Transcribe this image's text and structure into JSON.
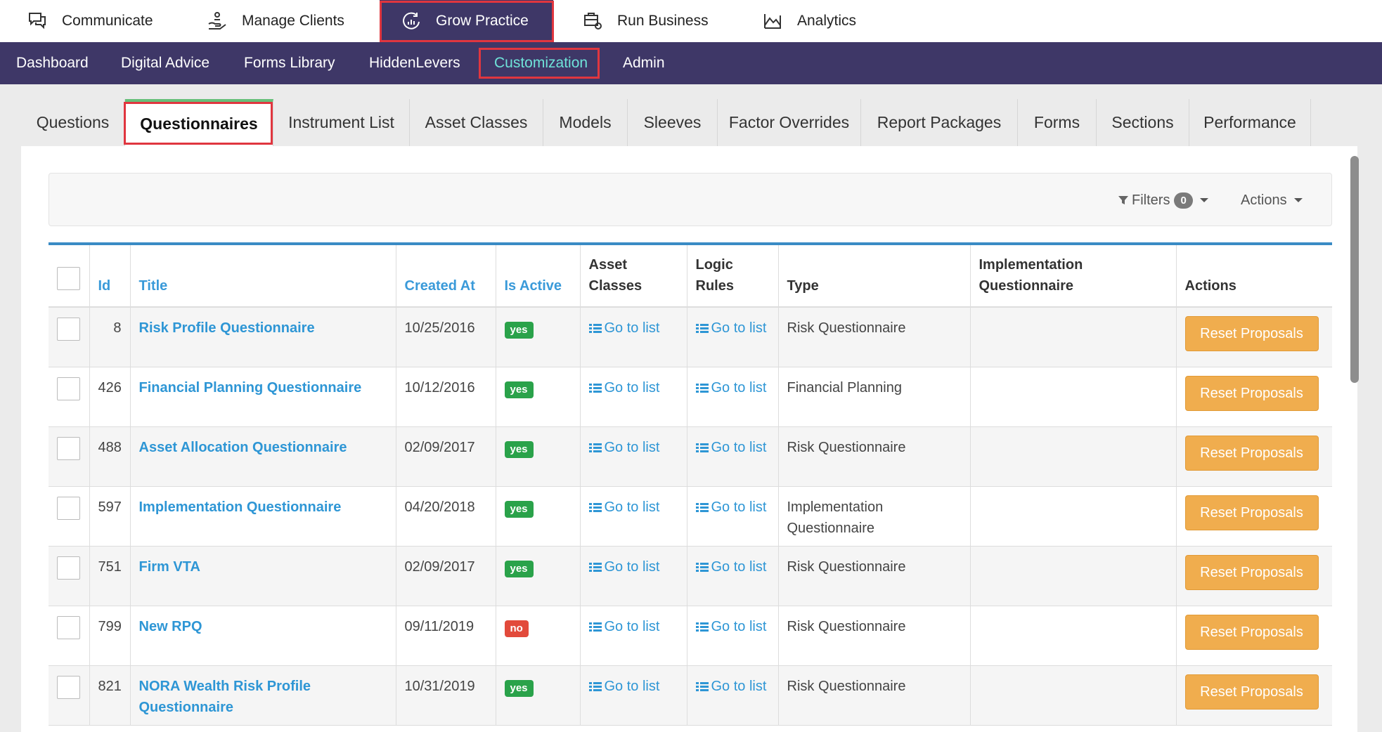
{
  "top_nav": {
    "items": [
      {
        "label": "Communicate",
        "icon": "chat-icon"
      },
      {
        "label": "Manage Clients",
        "icon": "hand-coins-icon"
      },
      {
        "label": "Grow Practice",
        "icon": "growth-chart-icon",
        "active": true
      },
      {
        "label": "Run Business",
        "icon": "business-gear-icon"
      },
      {
        "label": "Analytics",
        "icon": "mountain-chart-icon"
      }
    ]
  },
  "sub_nav": {
    "items": [
      {
        "label": "Dashboard"
      },
      {
        "label": "Digital Advice"
      },
      {
        "label": "Forms Library"
      },
      {
        "label": "HiddenLevers"
      },
      {
        "label": "Customization",
        "active": true
      },
      {
        "label": "Admin"
      }
    ]
  },
  "tabs": [
    {
      "label": "Questions"
    },
    {
      "label": "Questionnaires",
      "active": true
    },
    {
      "label": "Instrument List"
    },
    {
      "label": "Asset Classes"
    },
    {
      "label": "Models"
    },
    {
      "label": "Sleeves"
    },
    {
      "label": "Factor Overrides"
    },
    {
      "label": "Report Packages"
    },
    {
      "label": "Forms"
    },
    {
      "label": "Sections"
    },
    {
      "label": "Performance"
    }
  ],
  "toolbar": {
    "filters_label": "Filters",
    "filters_count": "0",
    "actions_label": "Actions"
  },
  "table": {
    "headers": {
      "id": "Id",
      "title": "Title",
      "created_at": "Created At",
      "is_active": "Is Active",
      "asset_classes": "Asset Classes",
      "logic_rules": "Logic Rules",
      "type": "Type",
      "implementation": "Implementation Questionnaire",
      "actions": "Actions"
    },
    "go_to_list": "Go to list",
    "reset_label": "Reset Proposals",
    "rows": [
      {
        "id": "8",
        "title": "Risk Profile Questionnaire",
        "created_at": "10/25/2016",
        "active": "yes",
        "type": "Risk Questionnaire",
        "implementation": ""
      },
      {
        "id": "426",
        "title": "Financial Planning Questionnaire",
        "created_at": "10/12/2016",
        "active": "yes",
        "type": "Financial Planning",
        "implementation": ""
      },
      {
        "id": "488",
        "title": "Asset Allocation Questionnaire",
        "created_at": "02/09/2017",
        "active": "yes",
        "type": "Risk Questionnaire",
        "implementation": ""
      },
      {
        "id": "597",
        "title": "Implementation Questionnaire",
        "created_at": "04/20/2018",
        "active": "yes",
        "type": "Implementation Questionnaire",
        "implementation": ""
      },
      {
        "id": "751",
        "title": "Firm VTA",
        "created_at": "02/09/2017",
        "active": "yes",
        "type": "Risk Questionnaire",
        "implementation": ""
      },
      {
        "id": "799",
        "title": "New RPQ",
        "created_at": "09/11/2019",
        "active": "no",
        "type": "Risk Questionnaire",
        "implementation": ""
      },
      {
        "id": "821",
        "title": "NORA Wealth Risk Profile Questionnaire",
        "created_at": "10/31/2019",
        "active": "yes",
        "type": "Risk Questionnaire",
        "implementation": ""
      }
    ]
  },
  "colors": {
    "nav_dark": "#3e3767",
    "active_teal": "#6fe3d9",
    "link_blue": "#2e96d5",
    "success_green": "#2aa24a",
    "danger_red": "#e24a3b",
    "warning_orange": "#f0ad4e",
    "highlight_red": "#e0363f"
  }
}
